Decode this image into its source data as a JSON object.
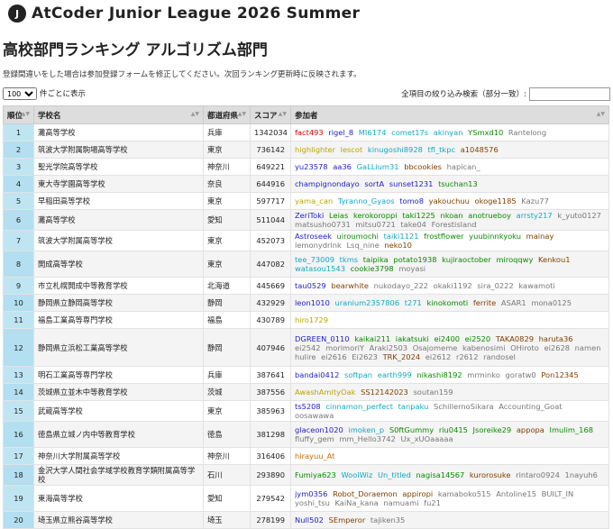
{
  "header": {
    "logo": "J",
    "site_title": "AtCoder Junior League 2026 Summer"
  },
  "page_title": "高校部門ランキング アルゴリズム部門",
  "notice": "登録間違いをした場合は参加登録フォームを修正してください。次回ランキング更新時に反映されます。",
  "controls": {
    "page_size": "100",
    "page_size_suffix": "件ごとに表示",
    "search_label": "全項目の絞り込み検索（部分一致）:"
  },
  "table": {
    "headers": {
      "rank": "順位",
      "school": "学校名",
      "prefecture": "都道府県",
      "score": "スコア",
      "members": "参加者"
    },
    "rows": [
      {
        "rank": "1",
        "school": "灘高等学校",
        "pref": "兵庫",
        "score": "1342034",
        "members": [
          [
            "fact493",
            "red"
          ],
          [
            "rigel_8",
            "blue"
          ],
          [
            "MI6174",
            "cyan"
          ],
          [
            "comet17s",
            "cyan"
          ],
          [
            "akinyan",
            "cyan"
          ],
          [
            "YSmxd10",
            "green"
          ],
          [
            "Rantelong",
            "gray"
          ]
        ]
      },
      {
        "rank": "2",
        "school": "筑波大学附属駒場高等学校",
        "pref": "東京",
        "score": "736142",
        "members": [
          [
            "highlighter",
            "yellow"
          ],
          [
            "lescot",
            "yellow"
          ],
          [
            "kinugoshi8928",
            "cyan"
          ],
          [
            "tfl_tkpc",
            "cyan"
          ],
          [
            "a1048576",
            "brown"
          ]
        ]
      },
      {
        "rank": "3",
        "school": "聖光学院高等学校",
        "pref": "神奈川",
        "score": "649221",
        "members": [
          [
            "yu23578",
            "blue"
          ],
          [
            "aa36",
            "blue"
          ],
          [
            "GaLLium31",
            "cyan"
          ],
          [
            "bbcookies",
            "brown"
          ],
          [
            "hapican_",
            "gray"
          ]
        ]
      },
      {
        "rank": "4",
        "school": "東大寺学園高等学校",
        "pref": "奈良",
        "score": "644916",
        "members": [
          [
            "champignondayo",
            "blue"
          ],
          [
            "sortA",
            "blue"
          ],
          [
            "sunset1231",
            "blue"
          ],
          [
            "tsuchan13",
            "green"
          ]
        ]
      },
      {
        "rank": "5",
        "school": "早稲田高等学校",
        "pref": "東京",
        "score": "597717",
        "members": [
          [
            "yama_can",
            "yellow"
          ],
          [
            "Tyranno_Gyaos",
            "cyan"
          ],
          [
            "tomo8",
            "blue"
          ],
          [
            "yakouchuu",
            "brown"
          ],
          [
            "okoge1185",
            "brown"
          ],
          [
            "Kazu77",
            "gray"
          ]
        ]
      },
      {
        "rank": "6",
        "school": "灘高等学校",
        "pref": "愛知",
        "score": "511044",
        "members": [
          [
            "ZeriToki",
            "blue"
          ],
          [
            "Leias",
            "green"
          ],
          [
            "kerokoroppi",
            "green"
          ],
          [
            "taki1225",
            "green"
          ],
          [
            "nkoan",
            "green"
          ],
          [
            "anotrueboy",
            "green"
          ],
          [
            "arrsty217",
            "cyan"
          ],
          [
            "k_yuto0127",
            "gray"
          ],
          [
            "matsusho0731",
            "gray"
          ],
          [
            "mitsu0721",
            "gray"
          ],
          [
            "take04",
            "gray"
          ],
          [
            "Forestisland",
            "gray"
          ]
        ]
      },
      {
        "rank": "7",
        "school": "筑波大学附属高等学校",
        "pref": "東京",
        "score": "452073",
        "members": [
          [
            "Astroseek",
            "blue"
          ],
          [
            "uiroumochi",
            "green"
          ],
          [
            "taiki1121",
            "cyan"
          ],
          [
            "frostflower",
            "green"
          ],
          [
            "yuubinnkyoku",
            "green"
          ],
          [
            "mainay",
            "brown"
          ],
          [
            "lemonydrink",
            "gray"
          ],
          [
            "Lsq_nine",
            "gray"
          ],
          [
            "neko10",
            "brown"
          ]
        ]
      },
      {
        "rank": "8",
        "school": "開成高等学校",
        "pref": "東京",
        "score": "447082",
        "members": [
          [
            "tee_73009",
            "cyan"
          ],
          [
            "tkms",
            "cyan"
          ],
          [
            "taipika",
            "green"
          ],
          [
            "potato1938",
            "green"
          ],
          [
            "kujiraoctober",
            "green"
          ],
          [
            "miroqqwy",
            "green"
          ],
          [
            "Kenkou1",
            "brown"
          ],
          [
            "watasou1543",
            "cyan"
          ],
          [
            "cookie3798",
            "green"
          ],
          [
            "moyasi",
            "gray"
          ]
        ]
      },
      {
        "rank": "9",
        "school": "市立札幌開成中等教育学校",
        "pref": "北海道",
        "score": "445669",
        "members": [
          [
            "tau0529",
            "blue"
          ],
          [
            "bearwhite",
            "brown"
          ],
          [
            "nukodayo_222",
            "gray"
          ],
          [
            "okaki1192",
            "gray"
          ],
          [
            "sira_0222",
            "gray"
          ],
          [
            "kawamoti",
            "gray"
          ]
        ]
      },
      {
        "rank": "10",
        "school": "静岡県立静岡高等学校",
        "pref": "静岡",
        "score": "432929",
        "members": [
          [
            "leon1010",
            "blue"
          ],
          [
            "uranium2357806",
            "cyan"
          ],
          [
            "t271",
            "cyan"
          ],
          [
            "kinokomoti",
            "green"
          ],
          [
            "ferrite",
            "brown"
          ],
          [
            "ASAR1",
            "gray"
          ],
          [
            "mona0125",
            "gray"
          ]
        ]
      },
      {
        "rank": "11",
        "school": "福島工業高等専門学校",
        "pref": "福島",
        "score": "430789",
        "members": [
          [
            "hiro1729",
            "yellow"
          ]
        ]
      },
      {
        "rank": "12",
        "school": "静岡県立浜松工業高等学校",
        "pref": "静岡",
        "score": "407946",
        "members": [
          [
            "DGREEN_0110",
            "blue"
          ],
          [
            "kaikai211",
            "green"
          ],
          [
            "iakatsuki",
            "green"
          ],
          [
            "ei2400",
            "green"
          ],
          [
            "ei2520",
            "green"
          ],
          [
            "TAKA0829",
            "brown"
          ],
          [
            "haruta36",
            "brown"
          ],
          [
            "ei2542",
            "gray"
          ],
          [
            "morimoriY",
            "gray"
          ],
          [
            "Araki2503",
            "gray"
          ],
          [
            "Osajomeme",
            "gray"
          ],
          [
            "kabenosimi",
            "gray"
          ],
          [
            "OHiroto",
            "gray"
          ],
          [
            "ei2628",
            "gray"
          ],
          [
            "namen",
            "gray"
          ],
          [
            "hulire",
            "gray"
          ],
          [
            "ei2616",
            "gray"
          ],
          [
            "Ei2623",
            "gray"
          ],
          [
            "TRK_2024",
            "brown"
          ],
          [
            "ei2612",
            "gray"
          ],
          [
            "r2612",
            "gray"
          ],
          [
            "randosel",
            "gray"
          ]
        ]
      },
      {
        "rank": "13",
        "school": "明石工業高等専門学校",
        "pref": "兵庫",
        "score": "387641",
        "members": [
          [
            "bandai0412",
            "blue"
          ],
          [
            "softpan",
            "cyan"
          ],
          [
            "earth999",
            "cyan"
          ],
          [
            "nikashi8192",
            "green"
          ],
          [
            "mrminko",
            "gray"
          ],
          [
            "goratw0",
            "gray"
          ],
          [
            "Pon12345",
            "brown"
          ]
        ]
      },
      {
        "rank": "14",
        "school": "茨城県立並木中等教育学校",
        "pref": "茨城",
        "score": "387556",
        "members": [
          [
            "AwashAmityOak",
            "yellow"
          ],
          [
            "SS12142023",
            "brown"
          ],
          [
            "soutan159",
            "gray"
          ]
        ]
      },
      {
        "rank": "15",
        "school": "武蔵高等学校",
        "pref": "東京",
        "score": "385963",
        "members": [
          [
            "ts5208",
            "blue"
          ],
          [
            "cinnamon_perfect",
            "cyan"
          ],
          [
            "tanpaku",
            "cyan"
          ],
          [
            "SchillernoSikara",
            "gray"
          ],
          [
            "Accounting_Goat",
            "gray"
          ],
          [
            "oosawawa",
            "gray"
          ]
        ]
      },
      {
        "rank": "16",
        "school": "徳島県立城ノ内中等教育学校",
        "pref": "徳島",
        "score": "381298",
        "members": [
          [
            "glaceon1020",
            "blue"
          ],
          [
            "imoken_p",
            "cyan"
          ],
          [
            "S0ftGummy",
            "green"
          ],
          [
            "riu0415",
            "green"
          ],
          [
            "Jsoreike29",
            "green"
          ],
          [
            "appopa",
            "brown"
          ],
          [
            "Imulim_168",
            "green"
          ],
          [
            "fluffy_gem",
            "gray"
          ],
          [
            "mm_Hello3742",
            "gray"
          ],
          [
            "Ux_xUOaaaaa",
            "gray"
          ]
        ]
      },
      {
        "rank": "17",
        "school": "神奈川大学附属高等学校",
        "pref": "神奈川",
        "score": "316406",
        "members": [
          [
            "hirayuu_At",
            "orange"
          ]
        ]
      },
      {
        "rank": "18",
        "school": "金沢大学人間社会学域学校教育学類附属高等学校",
        "pref": "石川",
        "score": "293890",
        "members": [
          [
            "Fumiya623",
            "green"
          ],
          [
            "WoolWiz",
            "cyan"
          ],
          [
            "Un_titled",
            "cyan"
          ],
          [
            "nagisa14567",
            "green"
          ],
          [
            "kurorosuke",
            "brown"
          ],
          [
            "rintaro0924",
            "gray"
          ],
          [
            "1nayuh6",
            "gray"
          ]
        ]
      },
      {
        "rank": "19",
        "school": "東海高等学校",
        "pref": "愛知",
        "score": "279542",
        "members": [
          [
            "jym0356",
            "blue"
          ],
          [
            "Robot_Doraemon",
            "brown"
          ],
          [
            "appiropi",
            "brown"
          ],
          [
            "kamaboko515",
            "gray"
          ],
          [
            "Antoline15",
            "gray"
          ],
          [
            "BUILT_IN",
            "gray"
          ],
          [
            "yoshi_tsu",
            "gray"
          ],
          [
            "KaiNa_kana",
            "gray"
          ],
          [
            "namuami",
            "gray"
          ],
          [
            "fu21",
            "gray"
          ]
        ]
      },
      {
        "rank": "20",
        "school": "埼玉県立熊谷高等学校",
        "pref": "埼玉",
        "score": "278199",
        "members": [
          [
            "Null502",
            "blue"
          ],
          [
            "SEmperor",
            "brown"
          ],
          [
            "tajiken35",
            "gray"
          ]
        ]
      }
    ]
  }
}
